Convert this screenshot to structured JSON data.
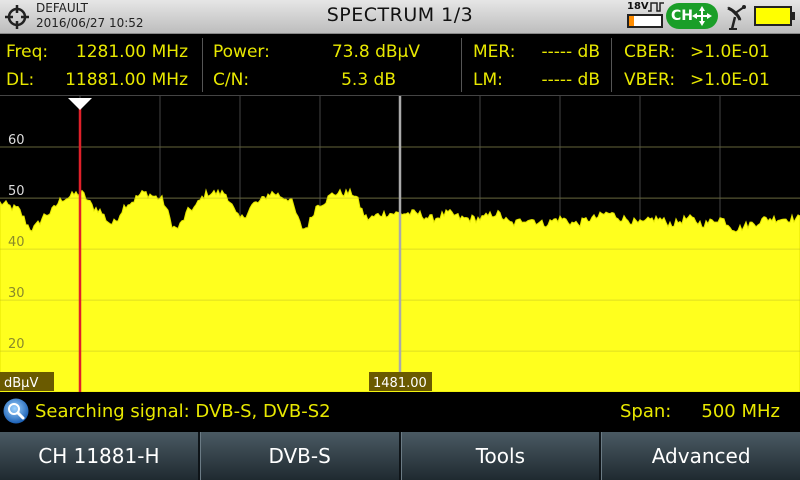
{
  "header": {
    "profile": "DEFAULT",
    "datetime": "2016/06/27 10:52",
    "title": "SPECTRUM 1/3",
    "lnb_voltage": "18V",
    "lnb_level": 0.15,
    "channel_mode": "CH",
    "battery_level": 1.0
  },
  "measurements": {
    "freq_label": "Freq:",
    "freq_value": "1281.00 MHz",
    "dl_label": "DL:",
    "dl_value": "11881.00 MHz",
    "power_label": "Power:",
    "power_value": "73.8 dBµV",
    "cn_label": "C/N:",
    "cn_value": "5.3 dB",
    "mer_label": "MER:",
    "mer_value": "----- dB",
    "lm_label": "LM:",
    "lm_value": "----- dB",
    "cber_label": "CBER:",
    "cber_value": ">1.0E-01",
    "vber_label": "VBER:",
    "vber_value": ">1.0E-01"
  },
  "plot": {
    "unit_label": "dBµV",
    "center_label": "1481.00",
    "y_ticks": [
      "60",
      "50",
      "40",
      "30",
      "20"
    ]
  },
  "chart_data": {
    "type": "area",
    "x_center_mhz": 1481,
    "span_mhz": 500,
    "ylim": [
      12,
      70
    ],
    "marker_x_mhz": 1281,
    "x_mhz": [
      1231,
      1241,
      1251,
      1261,
      1271,
      1281,
      1291,
      1301,
      1311,
      1321,
      1331,
      1341,
      1351,
      1361,
      1371,
      1381,
      1391,
      1401,
      1411,
      1421,
      1431,
      1441,
      1451,
      1461,
      1471,
      1481,
      1491,
      1501,
      1511,
      1521,
      1531,
      1541,
      1551,
      1561,
      1571,
      1581,
      1591,
      1601,
      1611,
      1621,
      1631,
      1641,
      1651,
      1661,
      1671,
      1681,
      1691,
      1701,
      1711,
      1721,
      1731
    ],
    "y_dbuv": [
      49,
      48,
      44,
      47,
      50,
      51,
      48,
      45,
      49,
      51,
      50,
      44,
      48,
      51,
      51,
      46,
      49,
      51,
      50,
      44,
      49,
      51,
      51,
      46,
      47,
      47,
      47,
      46,
      47,
      46,
      46,
      47,
      45,
      46,
      45,
      46,
      45,
      46,
      47,
      46,
      45,
      46,
      45,
      46,
      45,
      46,
      44,
      45,
      46,
      46,
      46
    ]
  },
  "status": {
    "text": "Searching signal: DVB-S, DVB-S2",
    "span_label": "Span:",
    "span_value": "500 MHz"
  },
  "softkeys": {
    "k1": "CH 11881-H",
    "k2": "DVB-S",
    "k3": "Tools",
    "k4": "Advanced"
  }
}
